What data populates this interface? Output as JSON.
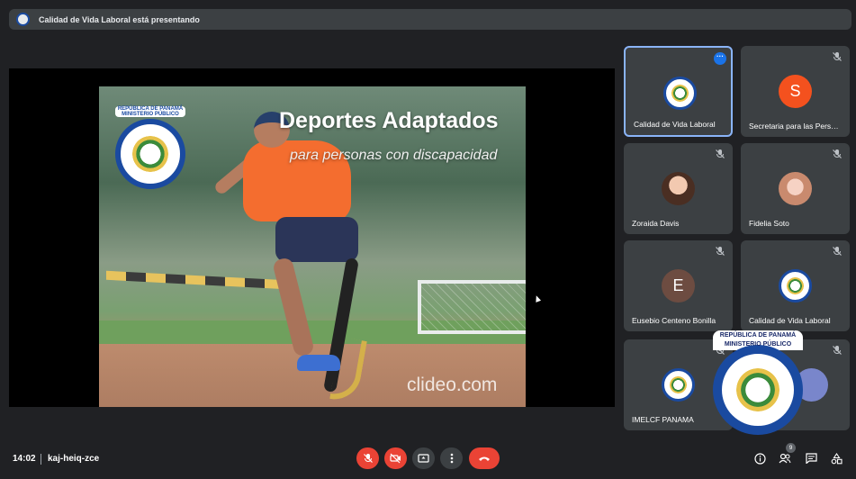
{
  "presenting": {
    "text": "Calidad de Vida Laboral está presentando",
    "icon": "institute-seal-icon"
  },
  "slide": {
    "title": "Deportes Adaptados",
    "subtitle": "para personas con discapacidad",
    "watermark": "clideo.com",
    "seal_caption": "REPÚBLICA DE PANAMÁ MINISTERIO PÚBLICO"
  },
  "participants": [
    {
      "name": "Calidad de Vida Laboral",
      "avatar": "seal",
      "active": true
    },
    {
      "name": "Secretaria para las Pers…",
      "avatar": "letter",
      "letter": "S",
      "color": "#f4511e",
      "muted": true
    },
    {
      "name": "Zoraida Davis",
      "avatar": "photo",
      "muted": true
    },
    {
      "name": "Fidelia Soto",
      "avatar": "photo",
      "muted": true
    },
    {
      "name": "Eusebio Centeno Bonilla",
      "avatar": "letter",
      "letter": "E",
      "color": "#6d4c41",
      "muted": true
    },
    {
      "name": "Calidad de Vida Laboral",
      "avatar": "seal",
      "muted": true
    },
    {
      "name": "IMELCF PANAMA",
      "avatar": "seal",
      "muted": true
    }
  ],
  "overlay_seal": {
    "header": "REPÚBLICA DE PANAMÁ MINISTERIO PÚBLICO"
  },
  "bottom": {
    "time": "14:02",
    "meeting_code": "kaj-heiq-zce",
    "people_count": "9"
  },
  "colors": {
    "accent_blue": "#8ab4f8",
    "end_call_red": "#ea4335",
    "tile_bg": "#3c4043"
  }
}
